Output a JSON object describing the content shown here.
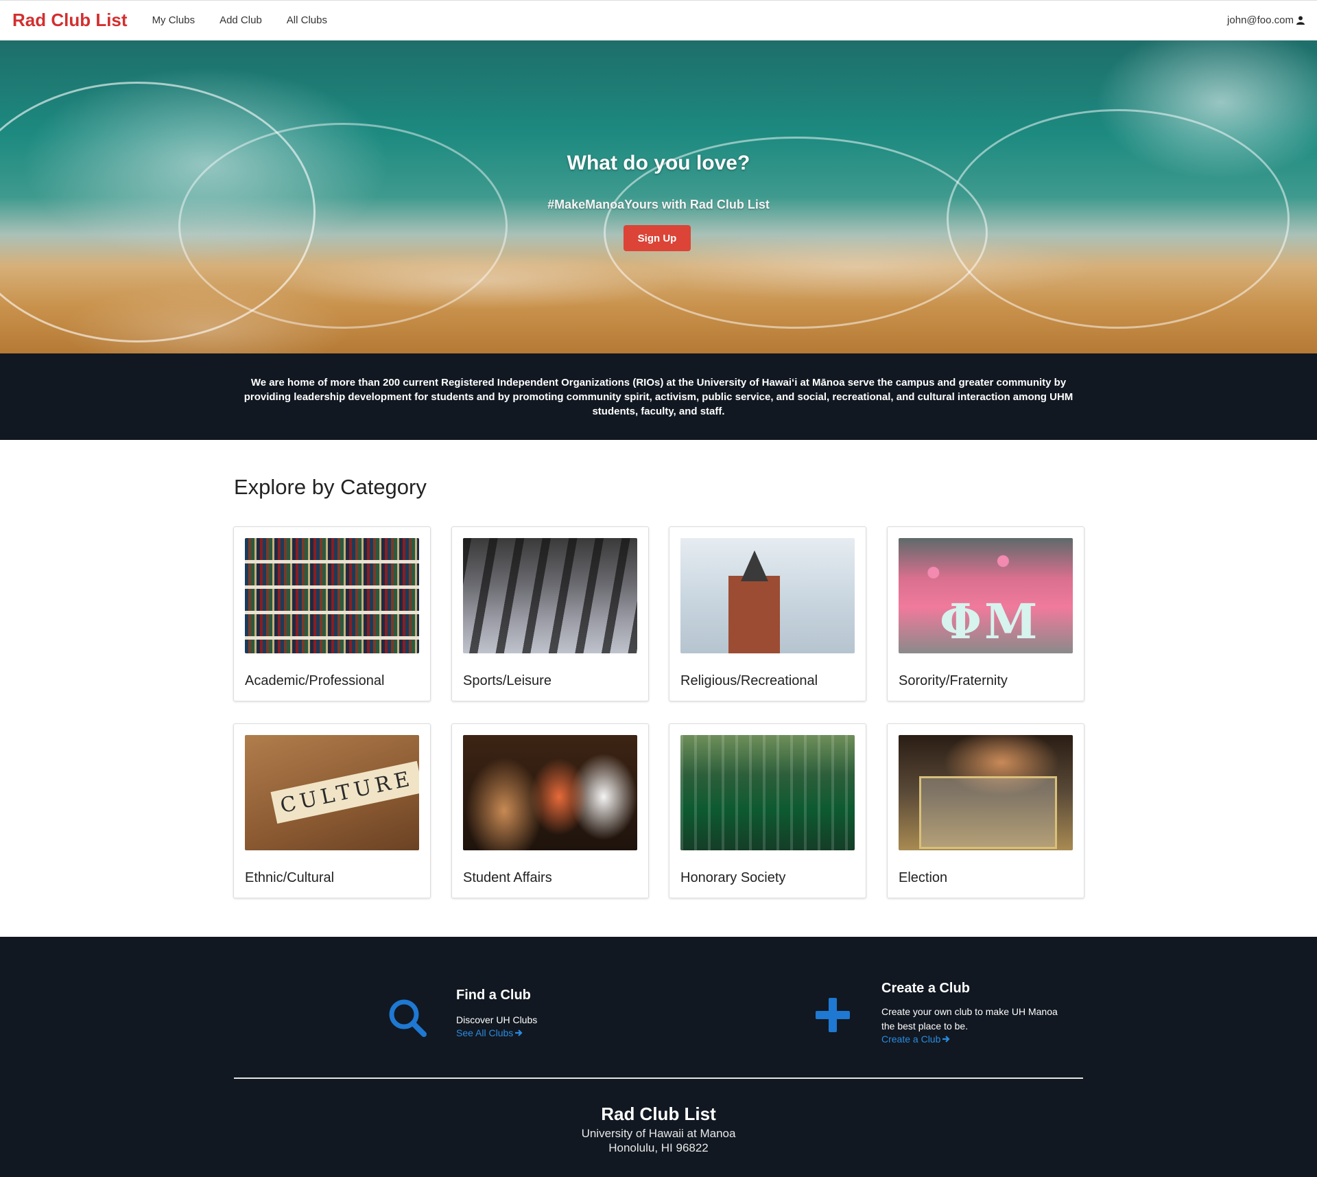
{
  "nav": {
    "brand": "Rad Club List",
    "links": [
      "My Clubs",
      "Add Club",
      "All Clubs"
    ],
    "user": "john@foo.com"
  },
  "hero": {
    "title": "What do you love?",
    "subtitle": "#MakeManoaYours with Rad Club List",
    "signup_label": "Sign Up"
  },
  "info": {
    "text": "We are home of more than 200 current Registered Independent Organizations (RIOs) at the University of Hawaiʻi at Mānoa serve the campus and greater community by providing leadership development for students and by promoting community spirit, activism, public service, and social, recreational, and cultural interaction among UHM students, faculty, and staff."
  },
  "explore": {
    "title": "Explore by Category",
    "categories": [
      {
        "label": "Academic/Professional",
        "icon": "bookshelf-photo"
      },
      {
        "label": "Sports/Leisure",
        "icon": "runners-photo"
      },
      {
        "label": "Religious/Recreational",
        "icon": "church-photo"
      },
      {
        "label": "Sorority/Fraternity",
        "icon": "sorority-photo"
      },
      {
        "label": "Ethnic/Cultural",
        "icon": "culture-tiles-photo"
      },
      {
        "label": "Student Affairs",
        "icon": "students-meeting-photo"
      },
      {
        "label": "Honorary Society",
        "icon": "graduation-photo"
      },
      {
        "label": "Election",
        "icon": "ballot-box-photo"
      }
    ]
  },
  "footer": {
    "find": {
      "title": "Find a Club",
      "text": "Discover UH Clubs",
      "link": "See All Clubs",
      "icon": "search-icon"
    },
    "create": {
      "title": "Create a Club",
      "text_line1": "Create your own club to make UH Manoa",
      "text_line2": "the best place to be.",
      "link": "Create a Club",
      "icon": "plus-icon"
    },
    "brand": "Rad Club List",
    "address_line1": "University of Hawaii at Manoa",
    "address_line2": "Honolulu, HI 96822"
  },
  "colors": {
    "brand_red": "#d32f2f",
    "signup_red": "#db4437",
    "dark_bg": "#111821",
    "link_blue": "#2b8be0",
    "icon_blue": "#1f78d1"
  }
}
